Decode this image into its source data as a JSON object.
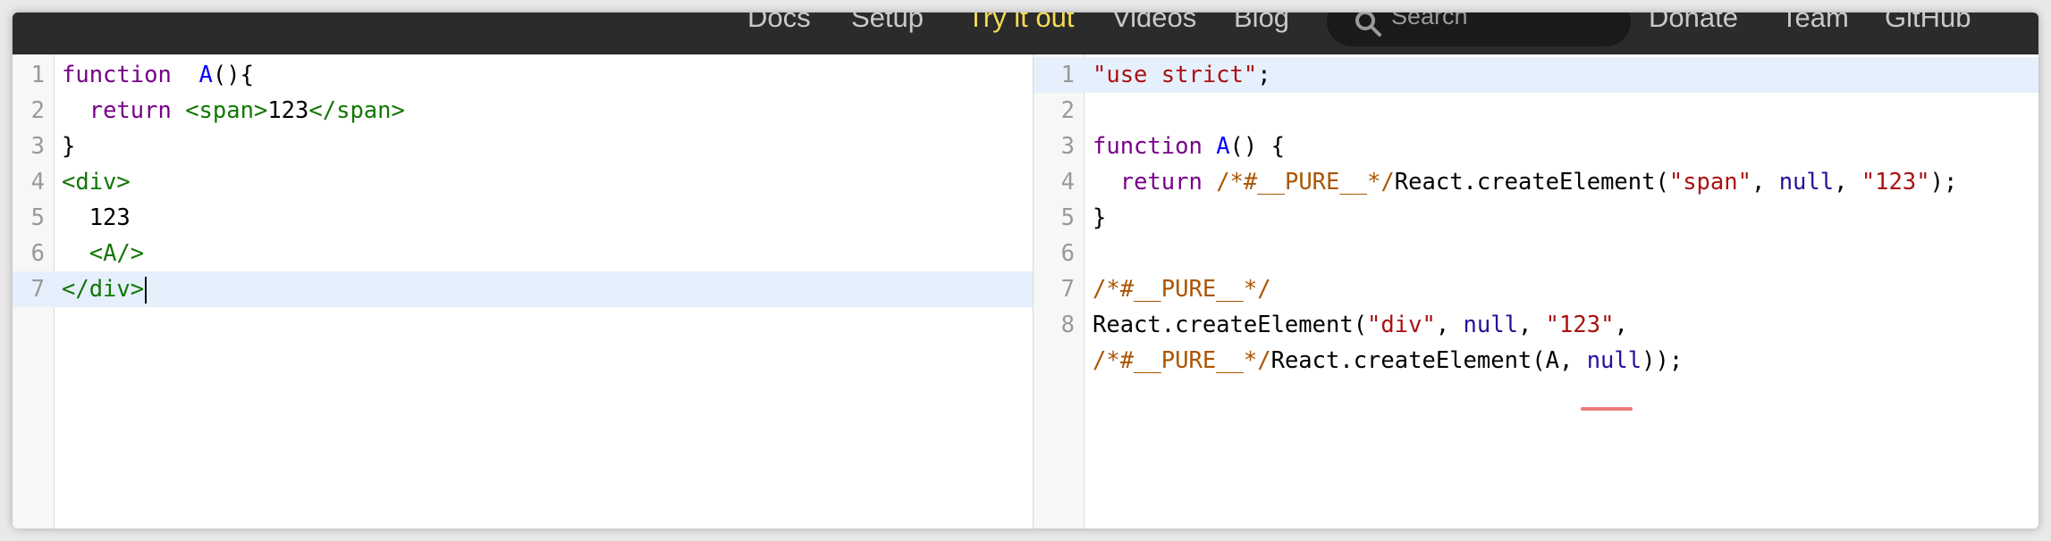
{
  "nav": {
    "items": [
      {
        "label": "Docs",
        "active": false
      },
      {
        "label": "Setup",
        "active": false
      },
      {
        "label": "Try it out",
        "active": true
      },
      {
        "label": "Videos",
        "active": false
      },
      {
        "label": "Blog",
        "active": false
      }
    ],
    "search_placeholder": "Search",
    "right_items": [
      {
        "label": "Donate"
      },
      {
        "label": "Team"
      },
      {
        "label": "GitHub"
      }
    ]
  },
  "editor": {
    "source": {
      "active_line": 7,
      "lines": [
        {
          "num": "1",
          "tokens": [
            [
              "kw",
              "function"
            ],
            [
              "",
              "  "
            ],
            [
              "def",
              "A"
            ],
            [
              "",
              "(){"
            ]
          ]
        },
        {
          "num": "2",
          "tokens": [
            [
              "",
              "  "
            ],
            [
              "kw",
              "return"
            ],
            [
              "",
              " "
            ],
            [
              "tag",
              "<span>"
            ],
            [
              "",
              "123"
            ],
            [
              "tag",
              "</span>"
            ]
          ]
        },
        {
          "num": "3",
          "tokens": [
            [
              "",
              "}"
            ]
          ]
        },
        {
          "num": "4",
          "tokens": [
            [
              "tag",
              "<div>"
            ]
          ]
        },
        {
          "num": "5",
          "tokens": [
            [
              "",
              "  123"
            ]
          ]
        },
        {
          "num": "6",
          "tokens": [
            [
              "",
              "  "
            ],
            [
              "tag",
              "<A/>"
            ]
          ]
        },
        {
          "num": "7",
          "tokens": [
            [
              "tag",
              "</div>"
            ]
          ]
        }
      ]
    },
    "output": {
      "active_line": 1,
      "lines": [
        {
          "num": "1",
          "tokens": [
            [
              "str",
              "\"use strict\""
            ],
            [
              "",
              ";"
            ]
          ]
        },
        {
          "num": "2",
          "tokens": []
        },
        {
          "num": "3",
          "tokens": [
            [
              "kw",
              "function"
            ],
            [
              "",
              " "
            ],
            [
              "def",
              "A"
            ],
            [
              "",
              "() {"
            ]
          ]
        },
        {
          "num": "4",
          "tokens": [
            [
              "",
              "  "
            ],
            [
              "kw",
              "return"
            ],
            [
              "",
              " "
            ],
            [
              "cmt",
              "/*#__PURE__*/"
            ],
            [
              "",
              "React.createElement("
            ],
            [
              "str",
              "\"span\""
            ],
            [
              "",
              ", "
            ],
            [
              "atom",
              "null"
            ],
            [
              "",
              ", "
            ],
            [
              "str",
              "\"123\""
            ],
            [
              "",
              ");"
            ]
          ]
        },
        {
          "num": "5",
          "tokens": [
            [
              "",
              "}"
            ]
          ]
        },
        {
          "num": "6",
          "tokens": []
        },
        {
          "num": "7",
          "tokens": [
            [
              "cmt",
              "/*#__PURE__*/"
            ]
          ]
        },
        {
          "num": "8",
          "tokens": [
            [
              "",
              "React.createElement("
            ],
            [
              "str",
              "\"div\""
            ],
            [
              "",
              ", "
            ],
            [
              "atom",
              "null"
            ],
            [
              "",
              ", "
            ],
            [
              "str",
              "\"123\""
            ],
            [
              "",
              ","
            ]
          ]
        },
        {
          "num": "",
          "tokens": [
            [
              "cmt",
              "/*#__PURE__*/"
            ],
            [
              "",
              "React.createElement(A, "
            ],
            [
              "atom",
              "null"
            ],
            [
              "",
              "));"
            ]
          ]
        }
      ]
    }
  },
  "colors": {
    "navbar": "#2b2b2b",
    "nav_active": "#f5da55",
    "active_line": "#e6f0fc",
    "keyword": "#770088",
    "definition": "#0000ff",
    "tag": "#117700",
    "string": "#aa1111",
    "atom": "#221199",
    "comment": "#aa5500",
    "squiggle": "#f07a7a"
  }
}
